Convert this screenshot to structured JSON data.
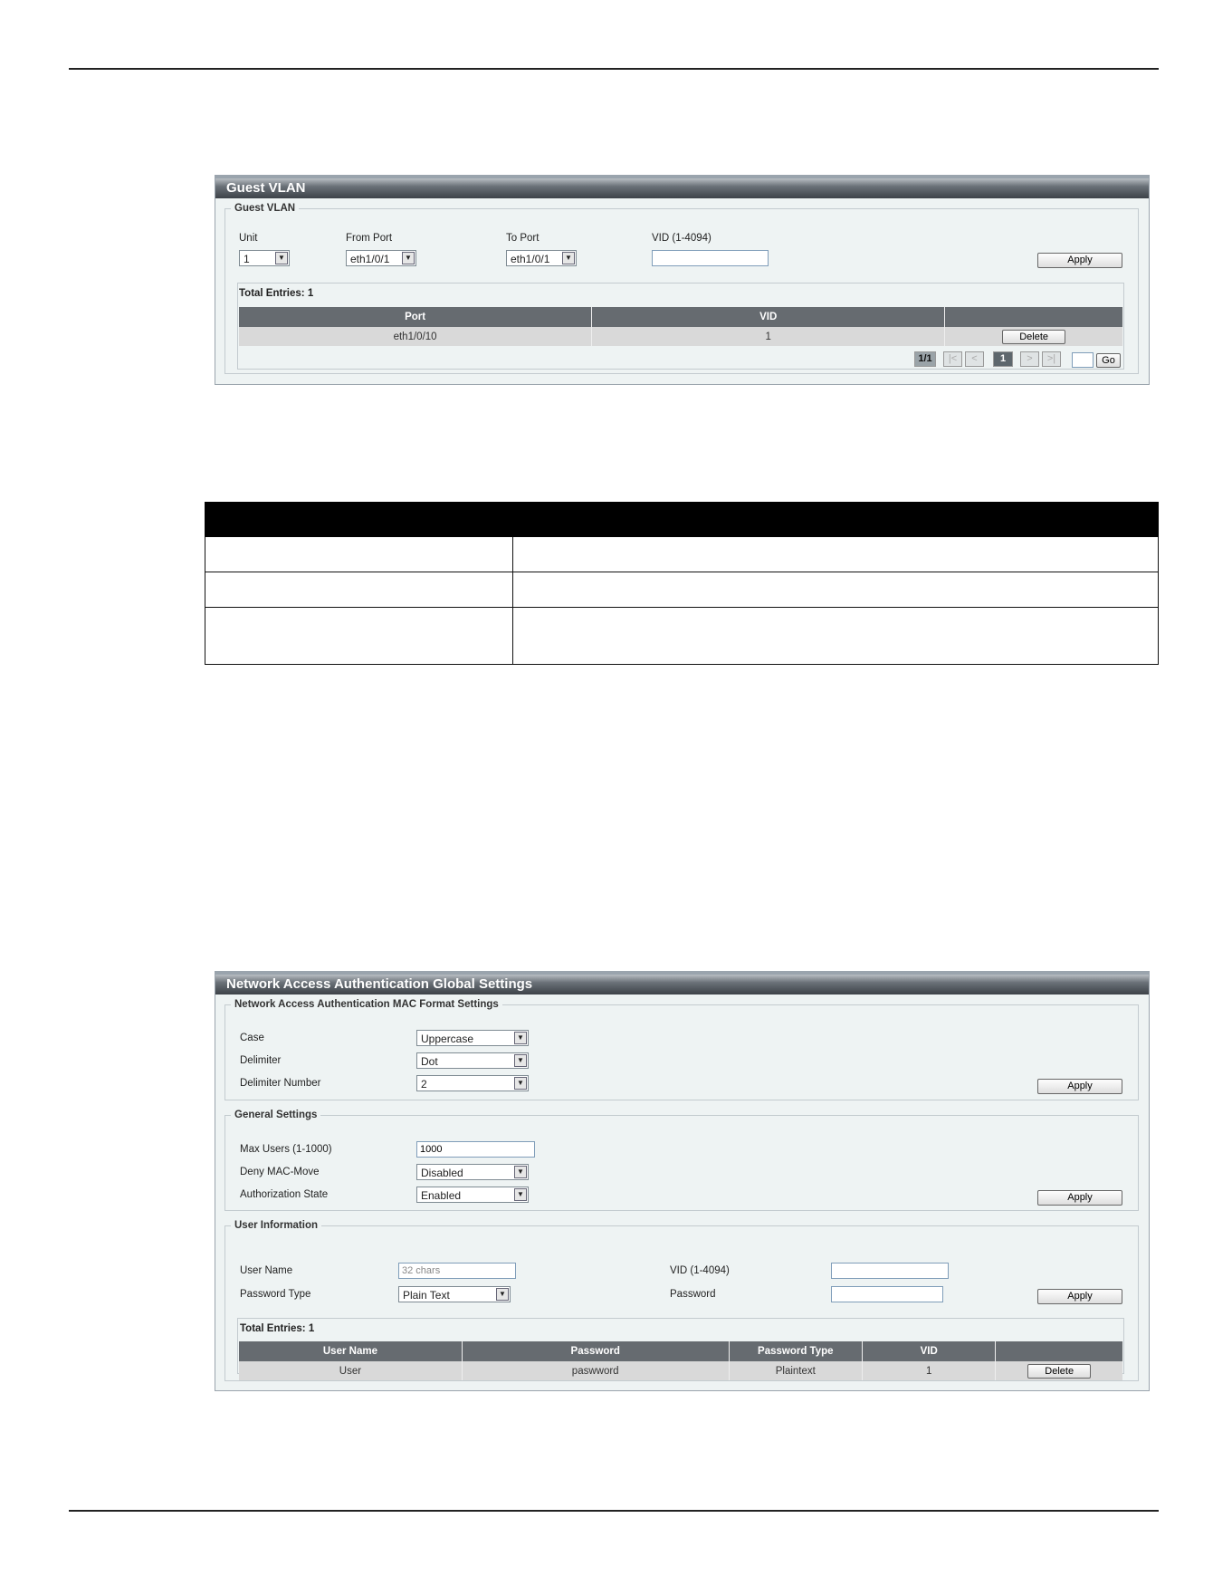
{
  "guest_vlan": {
    "title": "Guest VLAN",
    "fieldset_legend": "Guest VLAN",
    "unit": {
      "label": "Unit",
      "value": "1"
    },
    "from_port": {
      "label": "From Port",
      "value": "eth1/0/1"
    },
    "to_port": {
      "label": "To Port",
      "value": "eth1/0/1"
    },
    "vid": {
      "label": "VID (1-4094)",
      "value": ""
    },
    "apply_label": "Apply",
    "total_entries": "Total Entries: 1",
    "columns": [
      "Port",
      "VID",
      ""
    ],
    "rows": [
      {
        "port": "eth1/0/10",
        "vid": "1",
        "action": "Delete"
      }
    ],
    "pagination": {
      "indicator": "1/1",
      "first": "|<",
      "prev": "<",
      "current": "1",
      "next": ">",
      "last": ">|",
      "go_label": "Go"
    }
  },
  "nac_global": {
    "title": "Network Access Authentication Global Settings",
    "mac_format": {
      "legend": "Network Access Authentication MAC Format Settings",
      "case": {
        "label": "Case",
        "value": "Uppercase"
      },
      "delimiter": {
        "label": "Delimiter",
        "value": "Dot"
      },
      "delimiter_number": {
        "label": "Delimiter Number",
        "value": "2"
      },
      "apply_label": "Apply"
    },
    "general": {
      "legend": "General Settings",
      "max_users": {
        "label": "Max Users (1-1000)",
        "value": "1000"
      },
      "deny_mac_move": {
        "label": "Deny MAC-Move",
        "value": "Disabled"
      },
      "authorization_state": {
        "label": "Authorization State",
        "value": "Enabled"
      },
      "apply_label": "Apply"
    },
    "user_info": {
      "legend": "User Information",
      "user_name": {
        "label": "User Name",
        "placeholder": "32 chars"
      },
      "password_type": {
        "label": "Password Type",
        "value": "Plain Text"
      },
      "vid": {
        "label": "VID (1-4094)",
        "value": ""
      },
      "password": {
        "label": "Password",
        "value": ""
      },
      "apply_label": "Apply",
      "total_entries": "Total Entries: 1",
      "columns": [
        "User Name",
        "Password",
        "Password Type",
        "VID",
        ""
      ],
      "rows": [
        {
          "user_name": "User",
          "password": "paswword",
          "password_type": "Plaintext",
          "vid": "1",
          "action": "Delete"
        }
      ]
    }
  },
  "icons": {
    "dropdown_arrow": "▼"
  }
}
